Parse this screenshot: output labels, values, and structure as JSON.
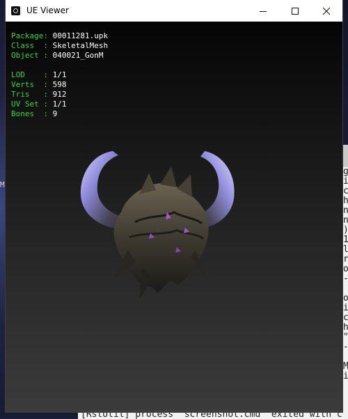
{
  "window": {
    "title": "UE Viewer",
    "minimize_label": "Minimize",
    "maximize_label": "Maximize",
    "close_label": "Close"
  },
  "mesh_info": {
    "group1": [
      {
        "key": "Package",
        "value": "00011281.upk"
      },
      {
        "key": "Class  ",
        "value": "SkeletalMesh"
      },
      {
        "key": "Object ",
        "value": "040021_GonM"
      }
    ],
    "group2": [
      {
        "key": "LOD    ",
        "value": "1/1"
      },
      {
        "key": "Verts  ",
        "value": "598"
      },
      {
        "key": "Tris   ",
        "value": "912"
      },
      {
        "key": "UV Set ",
        "value": "1/1"
      },
      {
        "key": "Bones  ",
        "value": "9"
      }
    ]
  },
  "background_terminal": {
    "lines": [
      "g",
      "i",
      "c",
      "h",
      "n",
      "n",
      ")",
      "1",
      "l",
      "r",
      "o",
      "-",
      "",
      "o",
      "i",
      "c",
      "h",
      "\"",
      "-",
      "",
      "M",
      "i"
    ]
  },
  "left_glyph": "M",
  "bottom_log": "[RstUtil] process \"screenshot.cmd\" exited with c",
  "colors": {
    "label_green": "#33d833",
    "value_white": "#ffffff",
    "horn_glow": "#b9b6ff"
  }
}
